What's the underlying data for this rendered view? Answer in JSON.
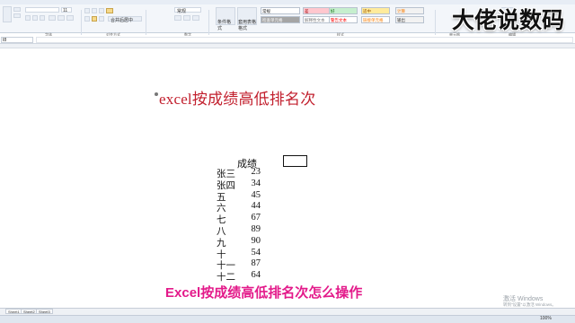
{
  "ribbon": {
    "font_size": "11",
    "merge_label": "合并后居中",
    "number_format": "常规",
    "conditional_format": "条件格式",
    "table_format": "套用表格格式",
    "group_font": "字体",
    "group_alignment": "对齐方式",
    "group_number": "数字",
    "group_styles": "样式",
    "group_cells": "单元格",
    "group_editing": "编辑",
    "styles": [
      {
        "label": "常规",
        "bg": "#ffffff",
        "fg": "#222222"
      },
      {
        "label": "差",
        "bg": "#ffc7ce",
        "fg": "#9c0006"
      },
      {
        "label": "好",
        "bg": "#c6efce",
        "fg": "#006100"
      },
      {
        "label": "适中",
        "bg": "#ffeb9c",
        "fg": "#9c5700"
      },
      {
        "label": "计算",
        "bg": "#f2f2f2",
        "fg": "#fa7d00"
      },
      {
        "label": "检查单元格",
        "bg": "#a5a5a5",
        "fg": "#ffffff"
      },
      {
        "label": "解释性文本",
        "bg": "#ffffff",
        "fg": "#7f7f7f"
      },
      {
        "label": "警告文本",
        "bg": "#ffffff",
        "fg": "#ff0000"
      },
      {
        "label": "链接单元格",
        "bg": "#ffffff",
        "fg": "#fa7d00"
      },
      {
        "label": "输出",
        "bg": "#f2f2f2",
        "fg": "#3f3f3f"
      }
    ]
  },
  "formula_bar": {
    "name_box": "I8"
  },
  "sheet": {
    "title": "excel按成绩高低排名次",
    "score_header": "成绩",
    "rows": [
      {
        "name": "张三",
        "score": "23"
      },
      {
        "name": "张四",
        "score": "34"
      },
      {
        "name": "五",
        "score": "45"
      },
      {
        "name": "六",
        "score": "44"
      },
      {
        "name": "七",
        "score": "67"
      },
      {
        "name": "八",
        "score": "89"
      },
      {
        "name": "九",
        "score": "90"
      },
      {
        "name": "十",
        "score": "54"
      },
      {
        "name": "十一",
        "score": "87"
      },
      {
        "name": "十二",
        "score": "64"
      }
    ]
  },
  "tabs": [
    "Sheet1",
    "Sheet2",
    "Sheet3"
  ],
  "status": {
    "zoom": "100%"
  },
  "overlay": {
    "watermark": "大佬说数码",
    "subtitle": "Excel按成绩高低排名次怎么操作",
    "activate_title": "激活 Windows",
    "activate_hint": "转到\"设置\"以激活 Windows。"
  }
}
